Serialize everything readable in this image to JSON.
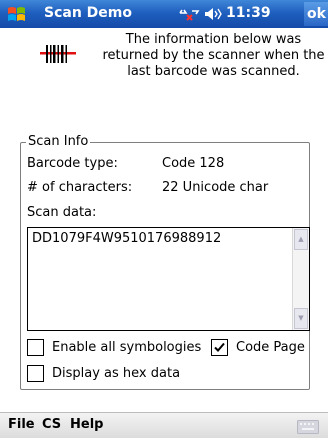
{
  "titlebar": {
    "app_title": "Scan Demo",
    "clock": "11:39",
    "ok_label": "ok"
  },
  "info": {
    "description": "The information below was returned by the scanner when the last barcode was scanned."
  },
  "scan_info": {
    "legend": "Scan Info",
    "barcode_type_label": "Barcode type:",
    "barcode_type_value": "Code 128",
    "num_chars_label": "# of characters:",
    "num_chars_value": "22 Unicode char",
    "scan_data_label": "Scan data:",
    "scan_data_value": "DD1079F4W9510176988912"
  },
  "options": {
    "enable_all_label": "Enable all symbologies",
    "enable_all_checked": false,
    "code_page_label": "Code Page",
    "code_page_checked": true,
    "hex_label": "Display as hex data",
    "hex_checked": false
  },
  "menubar": {
    "items": [
      "File",
      "CS",
      "Help"
    ]
  },
  "colors": {
    "titlebar": "#1f5fbf",
    "menubar": "#e6e6e6",
    "barcode_red": "#e01010"
  }
}
